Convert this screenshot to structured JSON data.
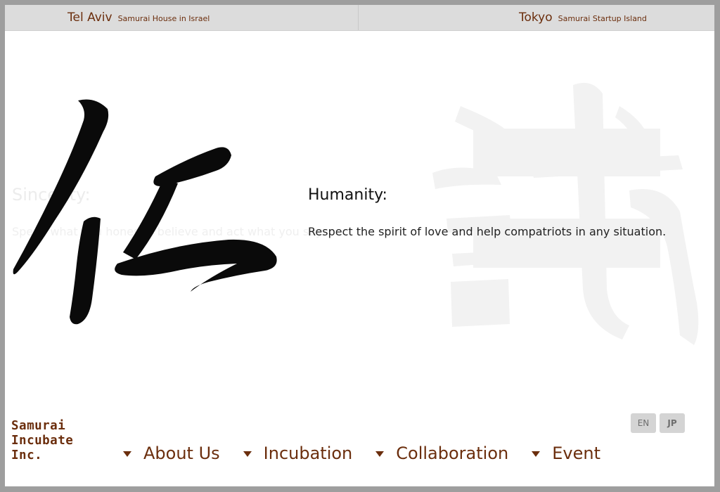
{
  "topbar": {
    "locations": [
      {
        "city": "Tel Aviv",
        "subtitle": "Samurai House in Israel"
      },
      {
        "city": "Tokyo",
        "subtitle": "Samurai Startup Island"
      }
    ]
  },
  "hero": {
    "kanji_icon": "jin-kanji-icon",
    "ghost_kanji_icon": "makoto-kanji-icon",
    "ghost_title": "Sincerity:",
    "ghost_text": "Speak what you honestly believe and act what you say.",
    "virtue_title": "Humanity:",
    "virtue_text": "Respect the spirit of love and help compatriots in any situation."
  },
  "footer": {
    "logo_lines": [
      "Samurai",
      "Incubate",
      "Inc."
    ],
    "nav": [
      {
        "label": "About Us"
      },
      {
        "label": "Incubation"
      },
      {
        "label": "Collaboration"
      },
      {
        "label": "Event"
      }
    ],
    "languages": [
      {
        "label": "EN"
      },
      {
        "label": "JP"
      }
    ]
  },
  "colors": {
    "brand_brown": "#6b2e0d",
    "topbar_bg": "#dcdcdc",
    "lang_button_bg": "#d4d4d4"
  }
}
